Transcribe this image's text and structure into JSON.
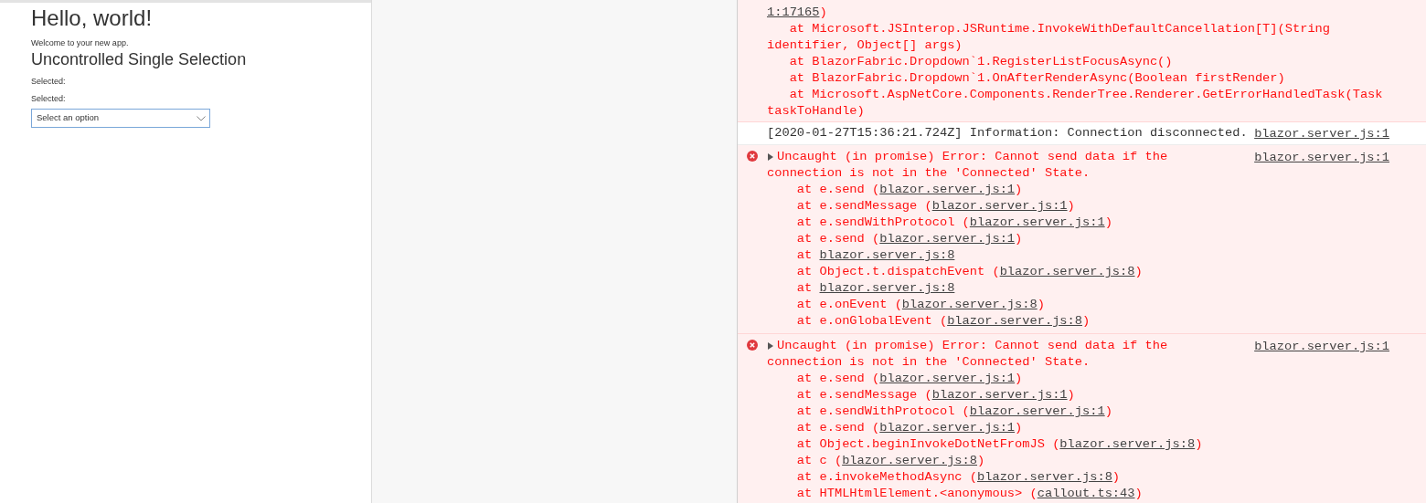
{
  "app": {
    "heading": "Hello, world!",
    "welcome": "Welcome to your new app.",
    "section_title": "Uncontrolled Single Selection",
    "selected_labels": [
      "Selected:",
      "Selected:"
    ],
    "dropdown": {
      "placeholder": "Select an option"
    }
  },
  "console": {
    "entries": [
      {
        "kind": "error",
        "continuation": true,
        "lines": [
          [
            {
              "text": "1:17165",
              "link": true
            },
            {
              "text": ")",
              "link": false
            }
          ],
          [
            {
              "text": "   at Microsoft.JSInterop.JSRuntime.InvokeWithDefaultCancellation[T](String",
              "link": false
            }
          ],
          [
            {
              "text": "identifier, Object[] args)",
              "link": false
            }
          ],
          [
            {
              "text": "   at BlazorFabric.Dropdown`1.RegisterListFocusAsync()",
              "link": false
            }
          ],
          [
            {
              "text": "   at BlazorFabric.Dropdown`1.OnAfterRenderAsync(Boolean firstRender)",
              "link": false
            }
          ],
          [
            {
              "text": "   at Microsoft.AspNetCore.Components.RenderTree.Renderer.GetErrorHandledTask(Task",
              "link": false
            }
          ],
          [
            {
              "text": "taskToHandle)",
              "link": false
            }
          ]
        ]
      },
      {
        "kind": "info",
        "continuation": false,
        "source": "blazor.server.js:1",
        "lines": [
          [
            {
              "text": "[2020-01-27T15:36:21.724Z] Information: Connection disconnected.",
              "link": false
            }
          ]
        ]
      },
      {
        "kind": "error",
        "continuation": false,
        "expanded": false,
        "source": "blazor.server.js:1",
        "lines": [
          [
            {
              "text": "Uncaught (in promise) Error: Cannot send data if the",
              "link": false
            }
          ],
          [
            {
              "text": "connection is not in the 'Connected' State.",
              "link": false
            }
          ],
          [
            {
              "text": "    at e.send (",
              "link": false
            },
            {
              "text": "blazor.server.js:1",
              "link": true
            },
            {
              "text": ")",
              "link": false
            }
          ],
          [
            {
              "text": "    at e.sendMessage (",
              "link": false
            },
            {
              "text": "blazor.server.js:1",
              "link": true
            },
            {
              "text": ")",
              "link": false
            }
          ],
          [
            {
              "text": "    at e.sendWithProtocol (",
              "link": false
            },
            {
              "text": "blazor.server.js:1",
              "link": true
            },
            {
              "text": ")",
              "link": false
            }
          ],
          [
            {
              "text": "    at e.send (",
              "link": false
            },
            {
              "text": "blazor.server.js:1",
              "link": true
            },
            {
              "text": ")",
              "link": false
            }
          ],
          [
            {
              "text": "    at ",
              "link": false
            },
            {
              "text": "blazor.server.js:8",
              "link": true
            }
          ],
          [
            {
              "text": "    at Object.t.dispatchEvent (",
              "link": false
            },
            {
              "text": "blazor.server.js:8",
              "link": true
            },
            {
              "text": ")",
              "link": false
            }
          ],
          [
            {
              "text": "    at ",
              "link": false
            },
            {
              "text": "blazor.server.js:8",
              "link": true
            }
          ],
          [
            {
              "text": "    at e.onEvent (",
              "link": false
            },
            {
              "text": "blazor.server.js:8",
              "link": true
            },
            {
              "text": ")",
              "link": false
            }
          ],
          [
            {
              "text": "    at e.onGlobalEvent (",
              "link": false
            },
            {
              "text": "blazor.server.js:8",
              "link": true
            },
            {
              "text": ")",
              "link": false
            }
          ]
        ]
      },
      {
        "kind": "error",
        "continuation": false,
        "expanded": false,
        "source": "blazor.server.js:1",
        "lines": [
          [
            {
              "text": "Uncaught (in promise) Error: Cannot send data if the",
              "link": false
            }
          ],
          [
            {
              "text": "connection is not in the 'Connected' State.",
              "link": false
            }
          ],
          [
            {
              "text": "    at e.send (",
              "link": false
            },
            {
              "text": "blazor.server.js:1",
              "link": true
            },
            {
              "text": ")",
              "link": false
            }
          ],
          [
            {
              "text": "    at e.sendMessage (",
              "link": false
            },
            {
              "text": "blazor.server.js:1",
              "link": true
            },
            {
              "text": ")",
              "link": false
            }
          ],
          [
            {
              "text": "    at e.sendWithProtocol (",
              "link": false
            },
            {
              "text": "blazor.server.js:1",
              "link": true
            },
            {
              "text": ")",
              "link": false
            }
          ],
          [
            {
              "text": "    at e.send (",
              "link": false
            },
            {
              "text": "blazor.server.js:1",
              "link": true
            },
            {
              "text": ")",
              "link": false
            }
          ],
          [
            {
              "text": "    at Object.beginInvokeDotNetFromJS (",
              "link": false
            },
            {
              "text": "blazor.server.js:8",
              "link": true
            },
            {
              "text": ")",
              "link": false
            }
          ],
          [
            {
              "text": "    at c (",
              "link": false
            },
            {
              "text": "blazor.server.js:8",
              "link": true
            },
            {
              "text": ")",
              "link": false
            }
          ],
          [
            {
              "text": "    at e.invokeMethodAsync (",
              "link": false
            },
            {
              "text": "blazor.server.js:8",
              "link": true
            },
            {
              "text": ")",
              "link": false
            }
          ],
          [
            {
              "text": "    at HTMLHtmlElement.<anonymous> (",
              "link": false
            },
            {
              "text": "callout.ts:43",
              "link": true
            },
            {
              "text": ")",
              "link": false
            }
          ]
        ]
      }
    ]
  }
}
